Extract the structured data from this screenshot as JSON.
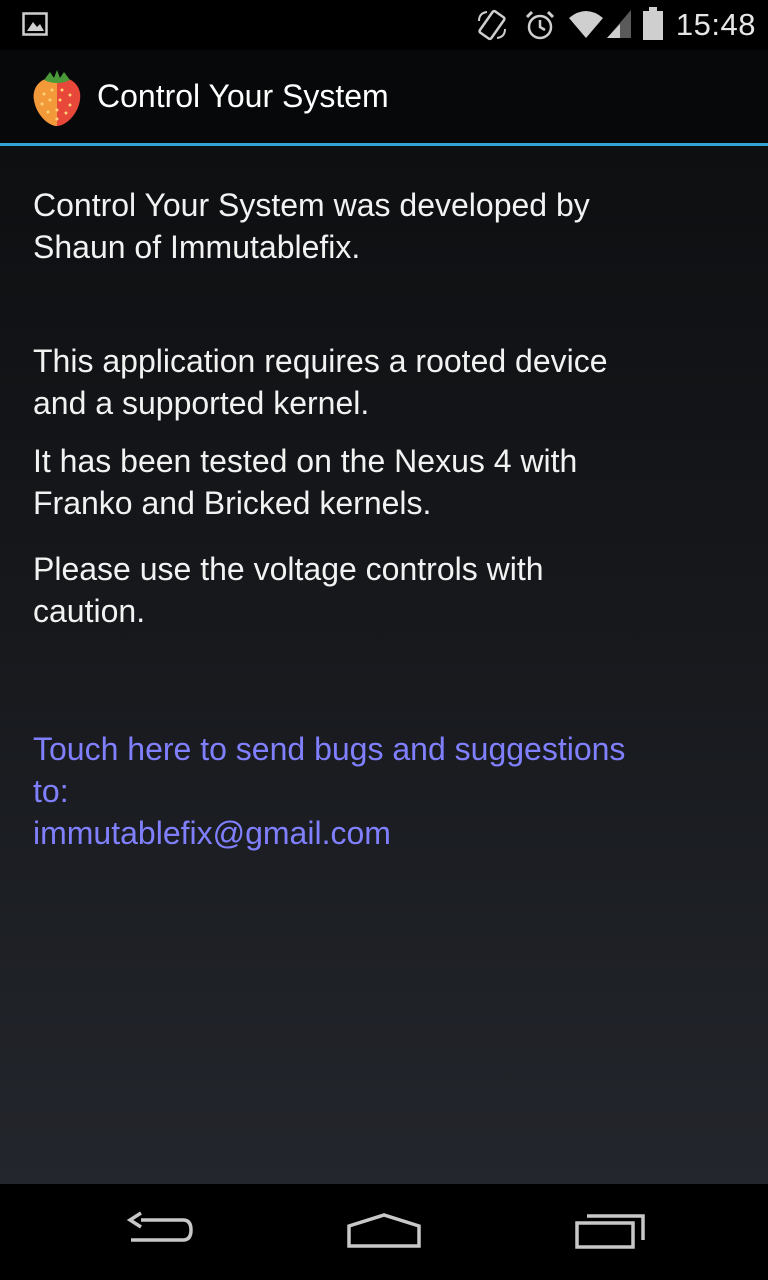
{
  "status_bar": {
    "time": "15:48",
    "icons": [
      "image-notification-icon",
      "screen-rotation-icon",
      "alarm-icon",
      "wifi-icon",
      "cell-signal-icon",
      "battery-icon"
    ]
  },
  "action_bar": {
    "title": "Control Your System",
    "app_icon": "strawberry-icon",
    "divider_color": "#33a3d6"
  },
  "content": {
    "paragraphs": [
      "Control Your System was developed by\nShaun of Immutablefix.",
      "This application requires a rooted device\nand a supported kernel.",
      "It has been tested on the Nexus 4 with\nFranko and Bricked kernels.",
      "Please use the voltage controls with\ncaution."
    ],
    "contact": {
      "line1": "Touch here to send bugs and suggestions",
      "line2": "to:",
      "email": "immutablefix@gmail.com",
      "color": "#8080ff"
    }
  },
  "nav_bar": {
    "buttons": [
      "back-icon",
      "home-icon",
      "recents-icon"
    ]
  }
}
